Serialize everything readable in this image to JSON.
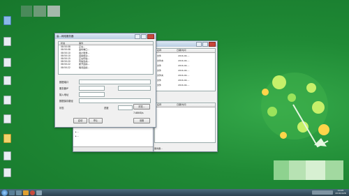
{
  "desktop": {
    "icons": [
      "computer-icon",
      "doc-icon",
      "doc-icon",
      "doc-icon",
      "doc-icon",
      "doc-icon",
      "folder-icon",
      "doc-icon",
      "doc-icon",
      "doc-icon"
    ],
    "brand_colors": {
      "green": "#1f8a35",
      "leaf": "#8bdc4a",
      "accent": "#ffd54a"
    }
  },
  "server_window": {
    "title": "高...网络服务器",
    "log_header": [
      "状态",
      "事件"
    ],
    "log": [
      [
        "08:50:08",
        "正在..."
      ],
      [
        "08:50:08",
        "监听端口..."
      ],
      [
        "08:50:10",
        "用户登录..."
      ],
      [
        "08:50:10",
        "连接成功..."
      ],
      [
        "08:50:15",
        "正在传输..."
      ],
      [
        "08:50:20",
        "传输完成..."
      ],
      [
        "08:50:22",
        "断开连接..."
      ],
      [
        "08:50:22",
        "等待连接..."
      ]
    ],
    "form": {
      "row1_label": "数据端口",
      "row1_value": "...",
      "row2_label": "服务器IP",
      "row3_label": "接入地址",
      "row4_label": "数据保存路径",
      "status_label": "状态",
      "progress_label": "进度",
      "speed_value": "7.68KB/s",
      "browse_button": "浏览...",
      "bottom_buttons": [
        "启动",
        "停止",
        "设置"
      ]
    }
  },
  "client_window": {
    "table_headers": [
      "名称",
      "日期/时间"
    ],
    "rows": [
      [
        "文件",
        "2016-04-..."
      ],
      [
        "文件夹",
        "2016-04-..."
      ],
      [
        "文件",
        "2016-04-..."
      ],
      [
        "文件",
        "2016-04-..."
      ],
      [
        "文件夹",
        "2016-04-..."
      ],
      [
        "文件",
        "2016-04-..."
      ],
      [
        "文件",
        "2016-04-..."
      ]
    ],
    "lower_headers": [
      "名称",
      "日期/时间"
    ],
    "statusbar": "服务器..."
  },
  "taskbar": {
    "clock_time": "10:05",
    "clock_date": "2016/4/26"
  }
}
